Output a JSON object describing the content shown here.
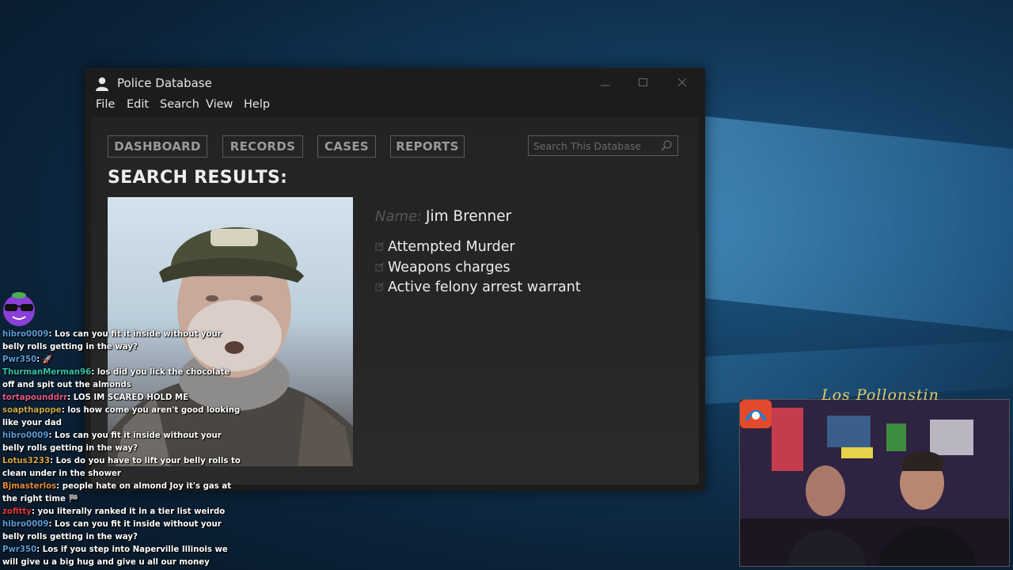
{
  "window": {
    "title": "Police Database",
    "title_icon": "user-icon",
    "controls": [
      "minimize-icon",
      "maximize-icon",
      "close-icon"
    ]
  },
  "menu": [
    "File",
    "Edit",
    "Search",
    "View",
    "Help"
  ],
  "nav": {
    "dashboard": "DASHBOARD",
    "records": "RECORDS",
    "cases": "CASES",
    "reports": "REPORTS"
  },
  "search": {
    "placeholder": "Search This Database",
    "icon": "search-icon"
  },
  "results": {
    "heading": "SEARCH RESULTS:",
    "name_label": "Name:",
    "name_value": "Jim Brenner",
    "charges": [
      "Attempted Murder",
      "Weapons charges",
      "Active felony arrest warrant"
    ]
  },
  "chat": [
    {
      "user": "hibro0009",
      "color": "#5b9ad6",
      "message": "Los can you fit it inside without your belly rolls getting in the way?"
    },
    {
      "user": "Pwr350",
      "color": "#5b9ad6",
      "message": "🚀"
    },
    {
      "user": "ThurmanMerman96",
      "color": "#35c2a0",
      "message": "los did you lick the chocolate off and spit out the almonds"
    },
    {
      "user": "tortapounddrr",
      "color": "#e05a82",
      "message": "LOS IM SCARED HOLD ME"
    },
    {
      "user": "soapthapope",
      "color": "#c9a84a",
      "message": "los how come you aren't good looking like your dad"
    },
    {
      "user": "hibro0009",
      "color": "#5b9ad6",
      "message": "Los can you fit it inside without your belly rolls getting in the way?"
    },
    {
      "user": "Lotus3233",
      "color": "#d9a441",
      "message": "Los do you have to lift your belly rolls to clean under in the shower"
    },
    {
      "user": "Bjmasterlos",
      "color": "#e08a3a",
      "message": "people hate on almond Joy it's gas at the right time 🏁"
    },
    {
      "user": "zofitty",
      "color": "#e03a3a",
      "message": "you literally ranked it in a tier list weirdo"
    },
    {
      "user": "hibro0009",
      "color": "#5b9ad6",
      "message": "Los can you fit it inside without your belly rolls getting in the way?"
    },
    {
      "user": "Pwr350",
      "color": "#5b9ad6",
      "message": "Los if you step into Naperville Illinois we will give u a big hug and give u all our money"
    }
  ],
  "overlay": {
    "signature": "Los Pollonstin"
  }
}
